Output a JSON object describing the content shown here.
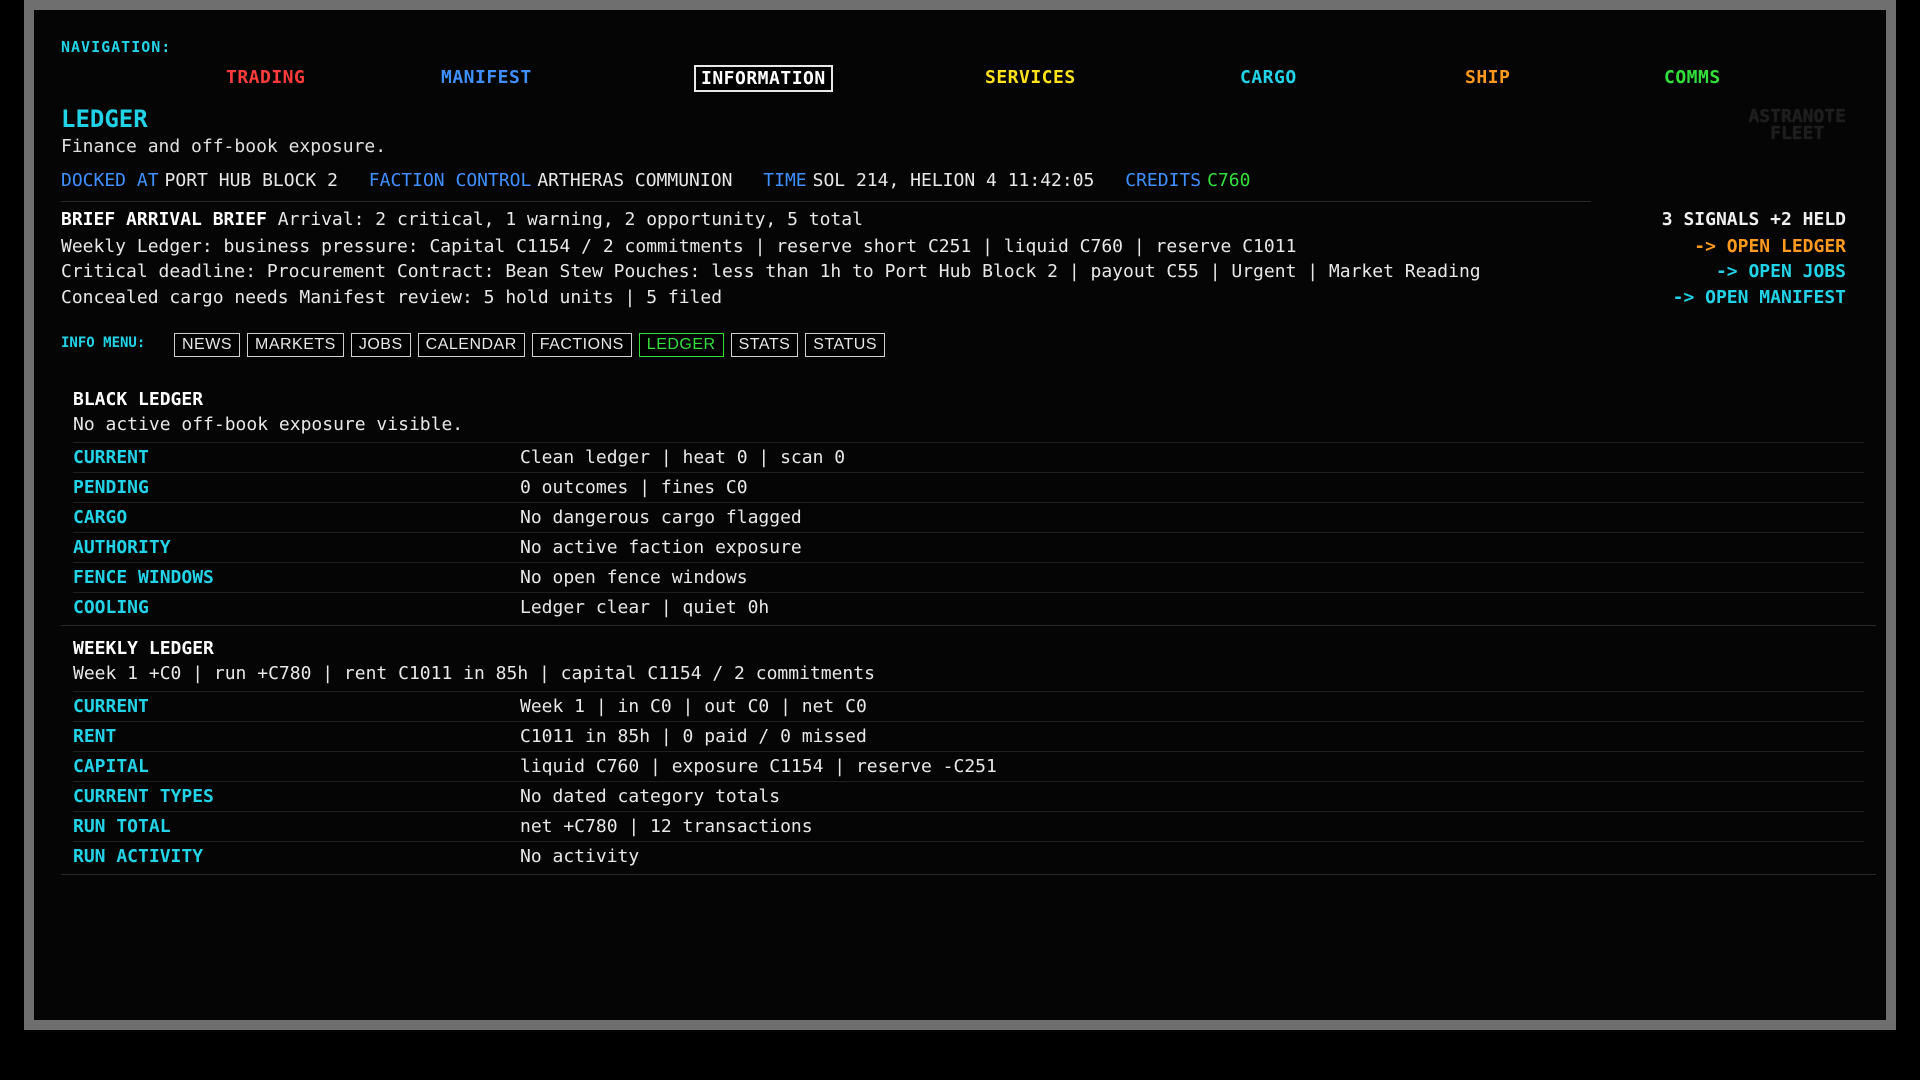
{
  "navigation": {
    "label": "NAVIGATION:",
    "items": [
      {
        "label": "TRADING",
        "color": "#ff3b3b"
      },
      {
        "label": "MANIFEST",
        "color": "#3f8fff"
      },
      {
        "label": "INFORMATION",
        "color": "#ffffff",
        "active": true
      },
      {
        "label": "SERVICES",
        "color": "#ffe21a"
      },
      {
        "label": "CARGO",
        "color": "#22d3e8"
      },
      {
        "label": "SHIP",
        "color": "#ff9a1e"
      },
      {
        "label": "COMMS",
        "color": "#33e03a"
      }
    ]
  },
  "page": {
    "title": "LEDGER",
    "subtitle": "Finance and off-book exposure.",
    "ghost_logo": [
      "ASTRANOTE",
      "FLEET"
    ]
  },
  "status_bar": {
    "docked_label": "DOCKED AT",
    "docked_value": "PORT HUB BLOCK 2",
    "faction_label": "FACTION CONTROL",
    "faction_value": "ARTHERAS COMMUNION",
    "time_label": "TIME",
    "time_value": "SOL 214, HELION 4 11:42:05",
    "credits_label": "CREDITS",
    "credits_value": "C760"
  },
  "brief": {
    "line1_prefix": "BRIEF ARRIVAL BRIEF",
    "line1": "Arrival: 2 critical, 1 warning, 2 opportunity, 5 total",
    "line1_right": "3 SIGNALS +2 HELD",
    "line2": "Weekly Ledger: business pressure: Capital C1154 / 2 commitments | reserve short C251 | liquid C760 | reserve C1011",
    "line2_right": "-> OPEN LEDGER",
    "line3": "Critical deadline: Procurement Contract: Bean Stew Pouches: less than 1h to Port Hub Block 2 | payout C55 | Urgent | Market Reading",
    "line3_right": "-> OPEN JOBS",
    "line4": "Concealed cargo needs Manifest review: 5 hold units | 5 filed",
    "line4_right": "-> OPEN MANIFEST"
  },
  "info_menu": {
    "label": "INFO MENU:",
    "tabs": [
      {
        "label": "NEWS"
      },
      {
        "label": "MARKETS"
      },
      {
        "label": "JOBS"
      },
      {
        "label": "CALENDAR"
      },
      {
        "label": "FACTIONS"
      },
      {
        "label": "LEDGER",
        "active": true
      },
      {
        "label": "STATS"
      },
      {
        "label": "STATUS"
      }
    ]
  },
  "black_ledger": {
    "title": "BLACK LEDGER",
    "subtitle": "No active off-book exposure visible.",
    "rows": [
      {
        "key": "CURRENT",
        "value": "Clean ledger | heat 0 | scan 0"
      },
      {
        "key": "PENDING",
        "value": "0 outcomes | fines C0"
      },
      {
        "key": "CARGO",
        "value": "No dangerous cargo flagged"
      },
      {
        "key": "AUTHORITY",
        "value": "No active faction exposure"
      },
      {
        "key": "FENCE WINDOWS",
        "value": "No open fence windows"
      },
      {
        "key": "COOLING",
        "value": "Ledger clear | quiet 0h"
      }
    ]
  },
  "weekly_ledger": {
    "title": "WEEKLY LEDGER",
    "subtitle": "Week 1 +C0 | run +C780 | rent C1011 in 85h | capital C1154 / 2 commitments",
    "rows": [
      {
        "key": "CURRENT",
        "value": "Week 1 | in C0 | out C0 | net C0"
      },
      {
        "key": "RENT",
        "value": "C1011 in 85h | 0 paid / 0 missed"
      },
      {
        "key": "CAPITAL",
        "value": "liquid C760 | exposure C1154 | reserve -C251"
      },
      {
        "key": "CURRENT TYPES",
        "value": "No dated category totals"
      },
      {
        "key": "RUN TOTAL",
        "value": "net +C780 | 12 transactions"
      },
      {
        "key": "RUN ACTIVITY",
        "value": "No activity"
      }
    ]
  }
}
